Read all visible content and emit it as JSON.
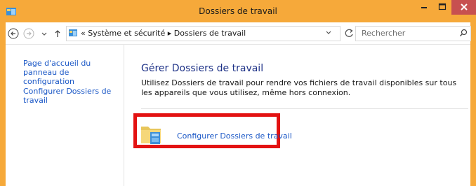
{
  "window": {
    "title": "Dossiers de travail",
    "colors": {
      "frame": "#f6a93a",
      "close": "#c75050",
      "link": "#1a57c6",
      "heading": "#1e3287",
      "highlight": "#e31212"
    }
  },
  "navbar": {
    "breadcrumb": "« Système et sécurité  ▸  Dossiers de travail",
    "search_placeholder": "Rechercher"
  },
  "sidebar": {
    "items": [
      {
        "label": "Page d'accueil du panneau de configuration"
      },
      {
        "label": "Configurer Dossiers de travail"
      }
    ]
  },
  "main": {
    "heading": "Gérer Dossiers de travail",
    "description": "Utilisez Dossiers de travail pour rendre vos fichiers de travail disponibles sur tous les appareils que vous utilisez, même hors connexion.",
    "action_link": "Configurer Dossiers de travail"
  },
  "icons": [
    "app-icon",
    "minimize-icon",
    "maximize-icon",
    "close-icon",
    "back-arrow-icon",
    "forward-arrow-icon",
    "chevron-down-icon",
    "up-arrow-icon",
    "control-panel-icon",
    "refresh-icon",
    "search-icon",
    "work-folders-icon"
  ]
}
